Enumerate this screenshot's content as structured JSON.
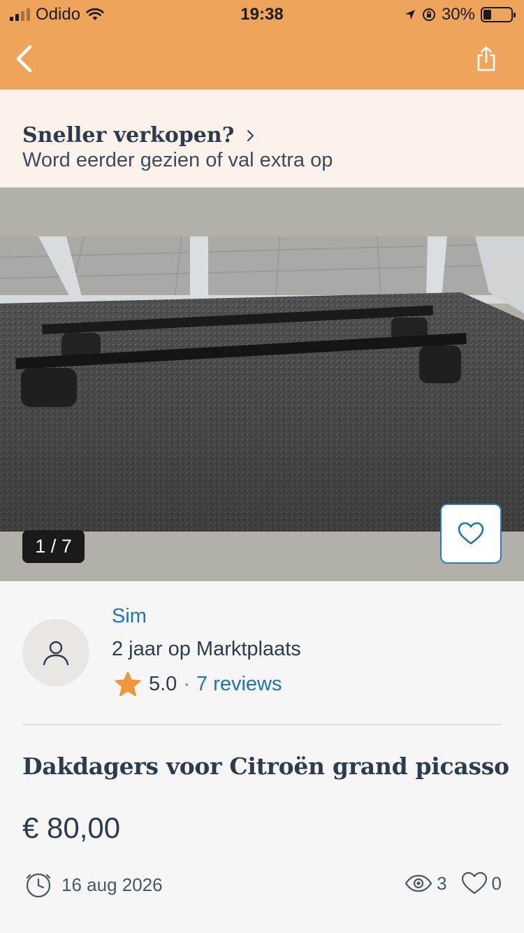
{
  "status_bar": {
    "carrier": "Odido",
    "time": "19:38",
    "battery": "30%",
    "battery_level": 0.3
  },
  "nav": {
    "back_icon": "chevron-left-icon",
    "share_icon": "share-icon"
  },
  "promo": {
    "title": "Sneller verkopen?",
    "subtitle": "Word eerder gezien of val extra op"
  },
  "gallery": {
    "counter": "1 / 7",
    "favorite_icon": "heart-icon"
  },
  "seller": {
    "name": "Sim",
    "member_since": "2 jaar op Marktplaats",
    "rating": "5.0",
    "separator": "·",
    "reviews": "7 reviews"
  },
  "listing": {
    "title": "Dakdagers voor Citroën grand picasso",
    "price": "€ 80,00",
    "date": "16 aug 2026",
    "views": "3",
    "favorites": "0"
  },
  "colors": {
    "header": "#eea55b",
    "promo_bg": "#fbf2ec",
    "link": "#2174b6",
    "text": "#2d3c4d",
    "star": "#f0963c"
  }
}
